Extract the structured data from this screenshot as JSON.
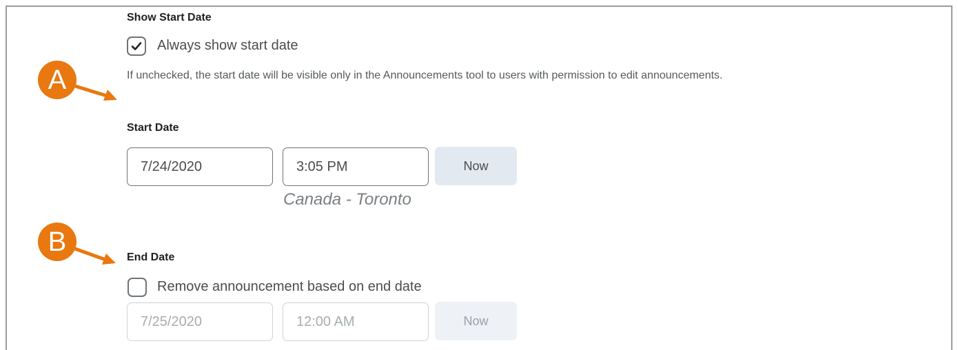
{
  "show_start": {
    "heading": "Show Start Date",
    "checkbox_label": "Always show start date",
    "checked": true,
    "help_text": "If unchecked, the start date will be visible only in the Announcements tool to users with permission to edit announcements."
  },
  "start_date": {
    "heading": "Start Date",
    "date_value": "7/24/2020",
    "time_value": "3:05 PM",
    "now_label": "Now",
    "timezone": "Canada - Toronto"
  },
  "end_date": {
    "heading": "End Date",
    "checkbox_label": "Remove announcement based on end date",
    "checked": false,
    "date_value": "7/25/2020",
    "time_value": "12:00 AM",
    "now_label": "Now"
  },
  "callouts": {
    "a_label": "A",
    "b_label": "B",
    "color": "#e8780f"
  }
}
